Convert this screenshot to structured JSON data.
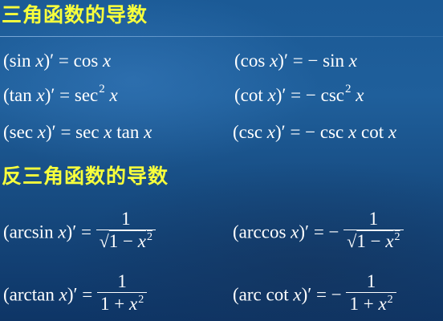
{
  "headings": {
    "derivatives_trig": "三角函数的导数",
    "derivatives_inverse_trig": "反三角函数的导数"
  },
  "formulas": {
    "sin_lhs_open": "(sin ",
    "sin_var": "x",
    "sin_lhs_close": ")′ = cos ",
    "sin_rhs_var": "x",
    "cos_lhs_open": "(cos ",
    "cos_var": "x",
    "cos_lhs_close": ")′ = − sin ",
    "cos_rhs_var": "x",
    "tan_lhs_open": "(tan ",
    "tan_var": "x",
    "tan_lhs_close": ")′ =  sec",
    "tan_exp": "2",
    "tan_rhs_var": "x",
    "cot_lhs_open": "(cot ",
    "cot_var": "x",
    "cot_lhs_close": ")′ = − csc",
    "cot_exp": "2",
    "cot_rhs_var": "x",
    "sec_lhs_open": "(sec ",
    "sec_var": "x",
    "sec_lhs_close": ")′ =  sec ",
    "sec_rhs_var1": "x",
    "sec_rhs_mid": " tan ",
    "sec_rhs_var2": "x",
    "csc_lhs_open": "(csc ",
    "csc_var": "x",
    "csc_lhs_close": ")′ = − csc ",
    "csc_rhs_var1": "x",
    "csc_rhs_mid": " cot ",
    "csc_rhs_var2": "x",
    "arcsin_lhs_open": "(arcsin ",
    "arcsin_var": "x",
    "arcsin_lhs_close": ")′ = ",
    "arcsin_num": "1",
    "arcsin_den_root": "√",
    "arcsin_den_text": "1 − ",
    "arcsin_den_var": "x",
    "arcsin_den_exp": "2",
    "arccos_lhs_open": "(arccos ",
    "arccos_var": "x",
    "arccos_lhs_close": ")′ = − ",
    "arccos_num": "1",
    "arccos_den_root": "√",
    "arccos_den_text": "1 − ",
    "arccos_den_var": "x",
    "arccos_den_exp": "2",
    "arctan_lhs_open": "(arctan ",
    "arctan_var": "x",
    "arctan_lhs_close": ")′ = ",
    "arctan_num": "1",
    "arctan_den_text": "1 + ",
    "arctan_den_var": "x",
    "arctan_den_exp": "2",
    "arccot_lhs_open": "(arc cot ",
    "arccot_var": "x",
    "arccot_lhs_close": ")′ = − ",
    "arccot_num": "1",
    "arccot_den_text": "1 + ",
    "arccot_den_var": "x",
    "arccot_den_exp": "2"
  }
}
